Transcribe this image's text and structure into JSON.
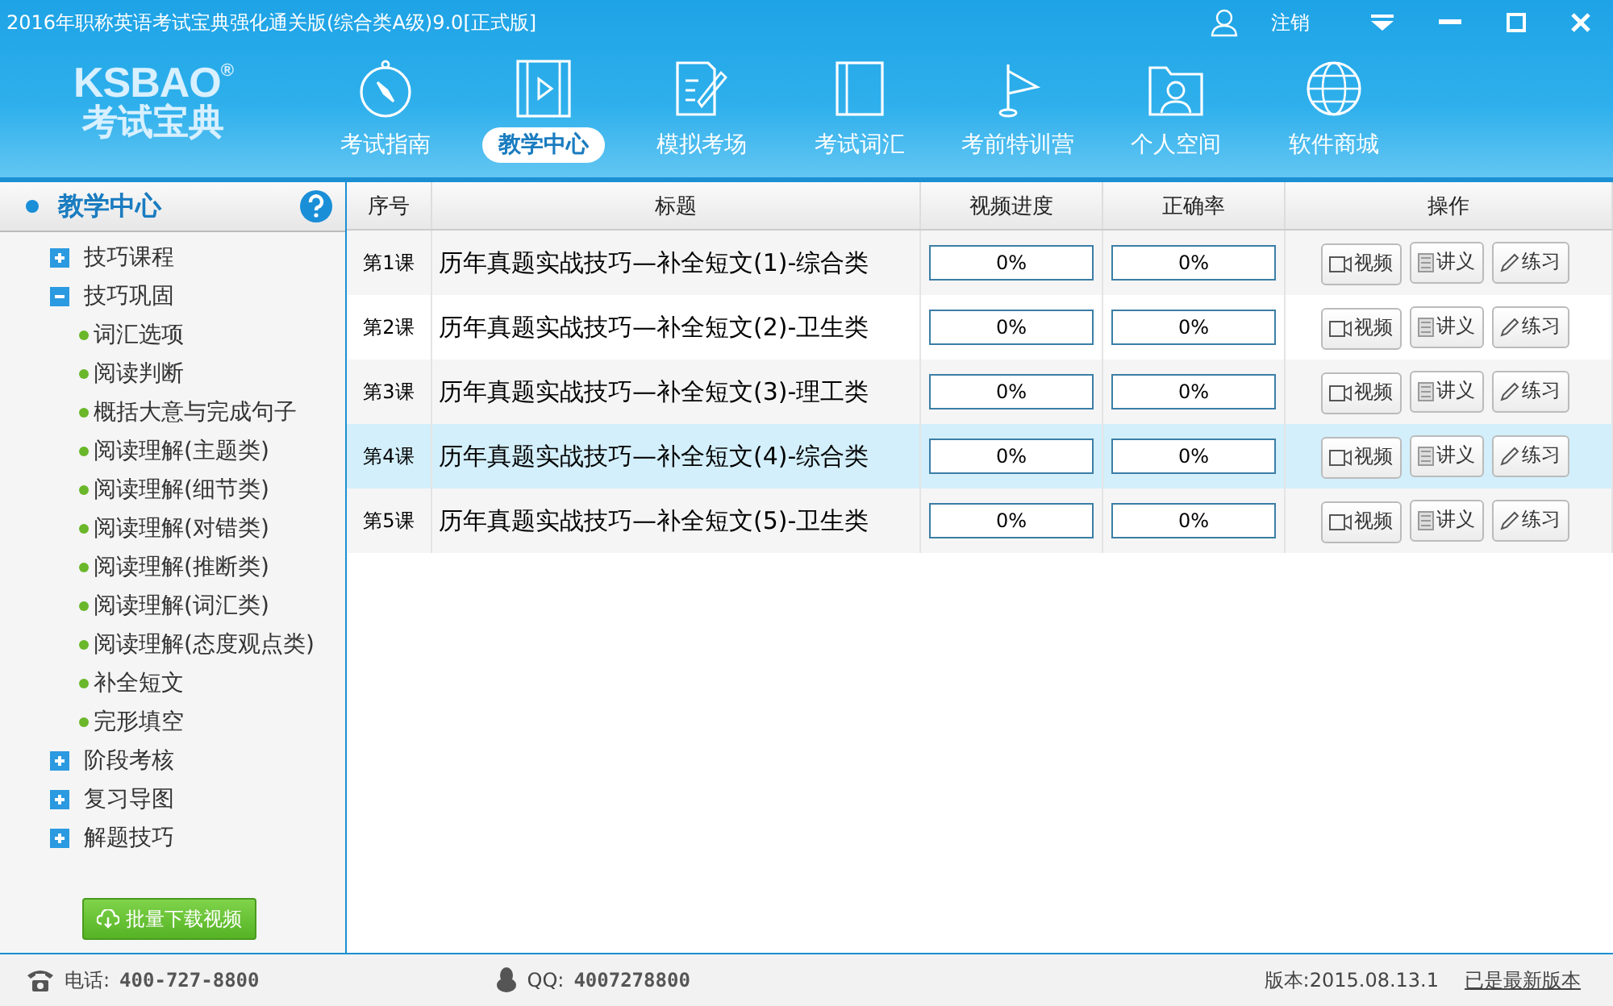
{
  "window": {
    "title": "2016年职称英语考试宝典强化通关版(综合类A级)9.0[正式版]",
    "logout": "注销"
  },
  "logo": {
    "brand": "KSBAO",
    "mark": "®",
    "name": "考试宝典"
  },
  "nav": [
    {
      "label": "考试指南",
      "selected": false
    },
    {
      "label": "教学中心",
      "selected": true
    },
    {
      "label": "模拟考场",
      "selected": false
    },
    {
      "label": "考试词汇",
      "selected": false
    },
    {
      "label": "考前特训营",
      "selected": false
    },
    {
      "label": "个人空间",
      "selected": false
    },
    {
      "label": "软件商城",
      "selected": false
    }
  ],
  "sidebar": {
    "title": "教学中心",
    "items": [
      {
        "label": "技巧课程",
        "expanded": false
      },
      {
        "label": "技巧巩固",
        "expanded": true,
        "children": [
          {
            "label": "词汇选项"
          },
          {
            "label": "阅读判断"
          },
          {
            "label": "概括大意与完成句子"
          },
          {
            "label": "阅读理解(主题类)"
          },
          {
            "label": "阅读理解(细节类)"
          },
          {
            "label": "阅读理解(对错类)"
          },
          {
            "label": "阅读理解(推断类)"
          },
          {
            "label": "阅读理解(词汇类)"
          },
          {
            "label": "阅读理解(态度观点类)"
          },
          {
            "label": "补全短文"
          },
          {
            "label": "完形填空"
          }
        ]
      },
      {
        "label": "阶段考核",
        "expanded": false
      },
      {
        "label": "复习导图",
        "expanded": false
      },
      {
        "label": "解题技巧",
        "expanded": false
      }
    ],
    "download_button": "批量下载视频"
  },
  "table": {
    "columns": [
      "序号",
      "标题",
      "视频进度",
      "正确率",
      "操作"
    ],
    "rows": [
      {
        "no": "第1课",
        "title": "历年真题实战技巧—补全短文(1)-综合类",
        "video": {
          "text": "0%"
        },
        "accuracy": {
          "text": "0%"
        },
        "actions": [
          "视频",
          "讲义",
          "练习"
        ],
        "selected": false
      },
      {
        "no": "第2课",
        "title": "历年真题实战技巧—补全短文(2)-卫生类",
        "video": {
          "text": "0%"
        },
        "accuracy": {
          "text": "0%"
        },
        "actions": [
          "视频",
          "讲义",
          "练习"
        ],
        "selected": false
      },
      {
        "no": "第3课",
        "title": "历年真题实战技巧—补全短文(3)-理工类",
        "video": {
          "text": "0%"
        },
        "accuracy": {
          "text": "0%"
        },
        "actions": [
          "视频",
          "讲义",
          "练习"
        ],
        "selected": false
      },
      {
        "no": "第4课",
        "title": "历年真题实战技巧—补全短文(4)-综合类",
        "video": {
          "text": "0%"
        },
        "accuracy": {
          "text": "0%"
        },
        "actions": [
          "视频",
          "讲义",
          "练习"
        ],
        "selected": true
      },
      {
        "no": "第5课",
        "title": "历年真题实战技巧—补全短文(5)-卫生类",
        "video": {
          "text": "0%"
        },
        "accuracy": {
          "text": "0%"
        },
        "actions": [
          "视频",
          "讲义",
          "练习"
        ],
        "selected": false
      }
    ]
  },
  "status_bar": {
    "phone_label": "电话:",
    "phone": "400-727-8800",
    "qq_label": "QQ:",
    "qq": "4007278800",
    "version": "版本:2015.08.13.1",
    "update_link": "已是最新版本"
  }
}
